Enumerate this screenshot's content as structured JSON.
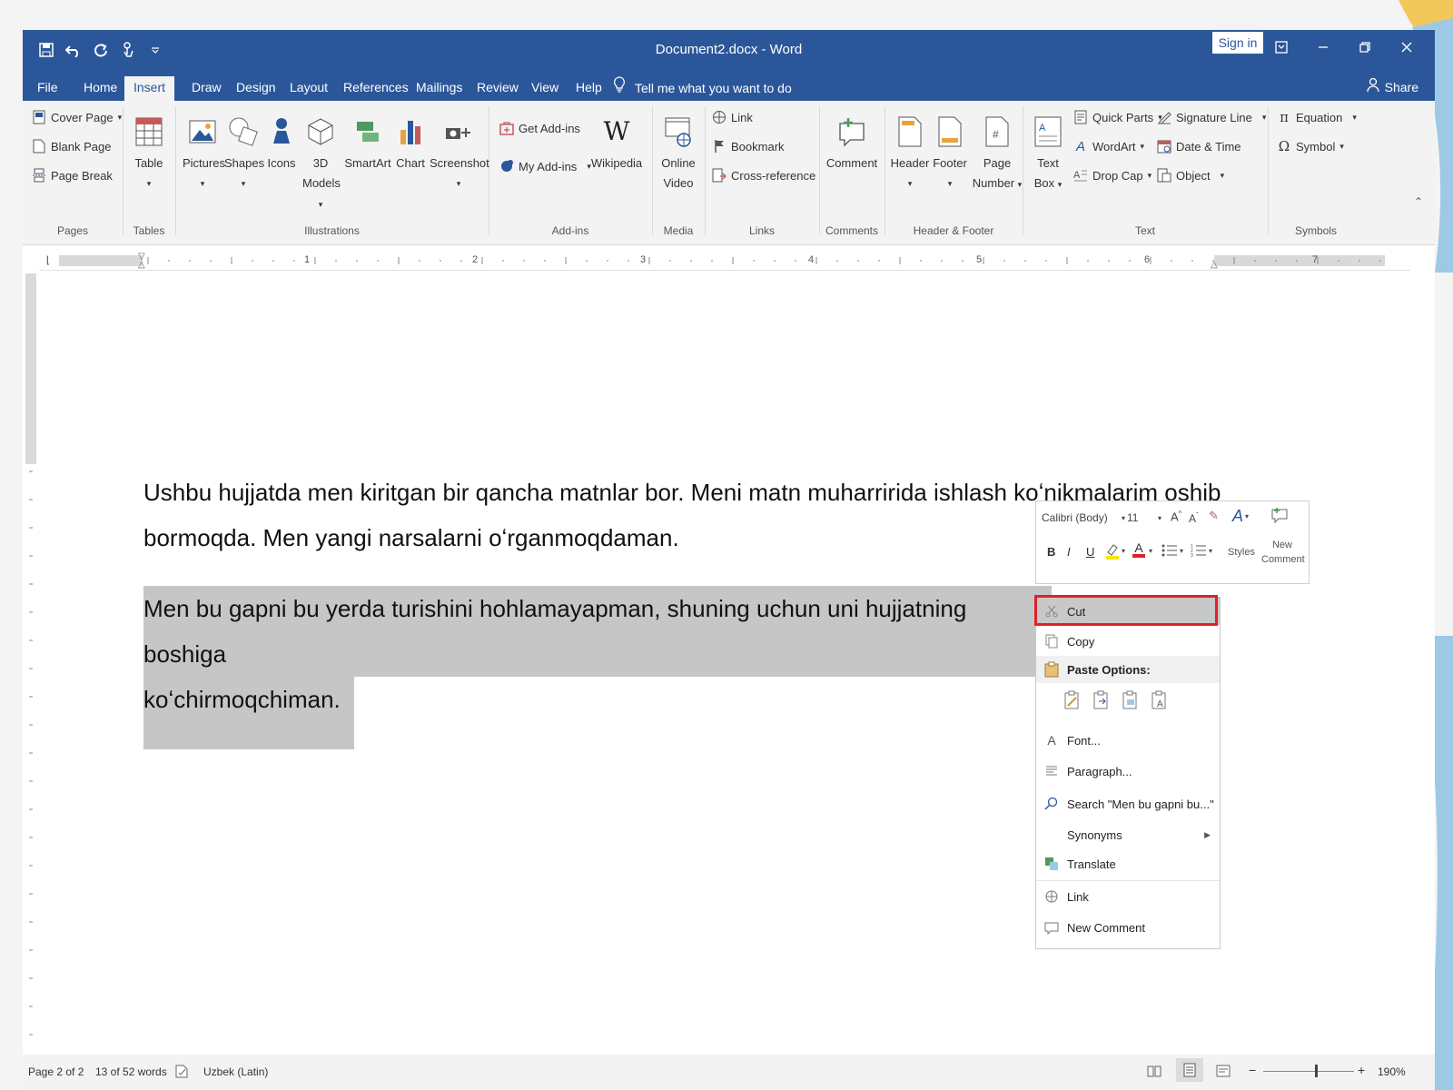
{
  "window": {
    "title": "Document2.docx  -  Word",
    "sign_in": "Sign in",
    "share": "Share",
    "tell_me": "Tell me what you want to do"
  },
  "tabs": [
    "File",
    "Home",
    "Insert",
    "Draw",
    "Design",
    "Layout",
    "References",
    "Mailings",
    "Review",
    "View",
    "Help"
  ],
  "active_tab": "Insert",
  "ribbon": {
    "pages": {
      "label": "Pages",
      "cover_page": "Cover Page",
      "blank_page": "Blank Page",
      "page_break": "Page Break"
    },
    "tables": {
      "label": "Tables",
      "table": "Table"
    },
    "illustrations": {
      "label": "Illustrations",
      "pictures": "Pictures",
      "shapes": "Shapes",
      "icons": "Icons",
      "models_3d_line1": "3D",
      "models_3d_line2": "Models",
      "smartart": "SmartArt",
      "chart": "Chart",
      "screenshot": "Screenshot"
    },
    "addins": {
      "label": "Add-ins",
      "get_addins": "Get Add-ins",
      "my_addins": "My Add-ins",
      "wikipedia": "Wikipedia"
    },
    "media": {
      "label": "Media",
      "online_video_line1": "Online",
      "online_video_line2": "Video"
    },
    "links": {
      "label": "Links",
      "link": "Link",
      "bookmark": "Bookmark",
      "cross_reference": "Cross-reference"
    },
    "comments": {
      "label": "Comments",
      "comment": "Comment"
    },
    "header_footer": {
      "label": "Header & Footer",
      "header": "Header",
      "footer": "Footer",
      "page_number_line1": "Page",
      "page_number_line2": "Number"
    },
    "text": {
      "label": "Text",
      "text_box_line1": "Text",
      "text_box_line2": "Box",
      "quick_parts": "Quick Parts",
      "wordart": "WordArt",
      "drop_cap": "Drop Cap",
      "signature_line": "Signature Line",
      "date_time": "Date & Time",
      "object": "Object"
    },
    "symbols": {
      "label": "Symbols",
      "equation": "Equation",
      "symbol": "Symbol"
    }
  },
  "ruler_numbers": [
    "1",
    "2",
    "3",
    "4",
    "5",
    "6",
    "7"
  ],
  "document": {
    "para1_line1": "Ushbu hujjatda men kiritgan bir qancha matnlar bor. Meni matn muharririda ishlash koʻnikmalarim oshib",
    "para1_line2": "bormoqda. Men yangi narsalarni oʻrganmoqdaman.",
    "para2_line1": "Men bu gapni bu yerda turishini hohlamayapman, shuning uchun uni hujjatning boshiga",
    "para2_line2": "koʻchirmoqchiman."
  },
  "mini_toolbar": {
    "font": "Calibri (Body)",
    "size": "11",
    "bold": "B",
    "italic": "I",
    "underline": "U",
    "styles": "Styles",
    "new_comment_line1": "New",
    "new_comment_line2": "Comment"
  },
  "context_menu": {
    "cut": "Cut",
    "copy": "Copy",
    "paste_options": "Paste Options:",
    "font": "Font...",
    "paragraph": "Paragraph...",
    "search": "Search \"Men bu gapni bu...\"",
    "synonyms": "Synonyms",
    "translate": "Translate",
    "link": "Link",
    "new_comment": "New Comment"
  },
  "status": {
    "page": "Page 2 of 2",
    "words": "13 of 52 words",
    "language": "Uzbek (Latin)",
    "zoom": "190%"
  },
  "colors": {
    "accent": "#2b579a",
    "selection": "#c6c6c6",
    "highlight_box": "#e0202a"
  },
  "icons": [
    "save-icon",
    "undo-icon",
    "redo-icon",
    "touch-mode-icon",
    "lightbulb-icon",
    "person-icon",
    "cut-icon",
    "copy-icon",
    "paste-icon",
    "font-icon",
    "paragraph-icon",
    "search-icon",
    "translate-icon",
    "link-icon",
    "comment-icon"
  ]
}
